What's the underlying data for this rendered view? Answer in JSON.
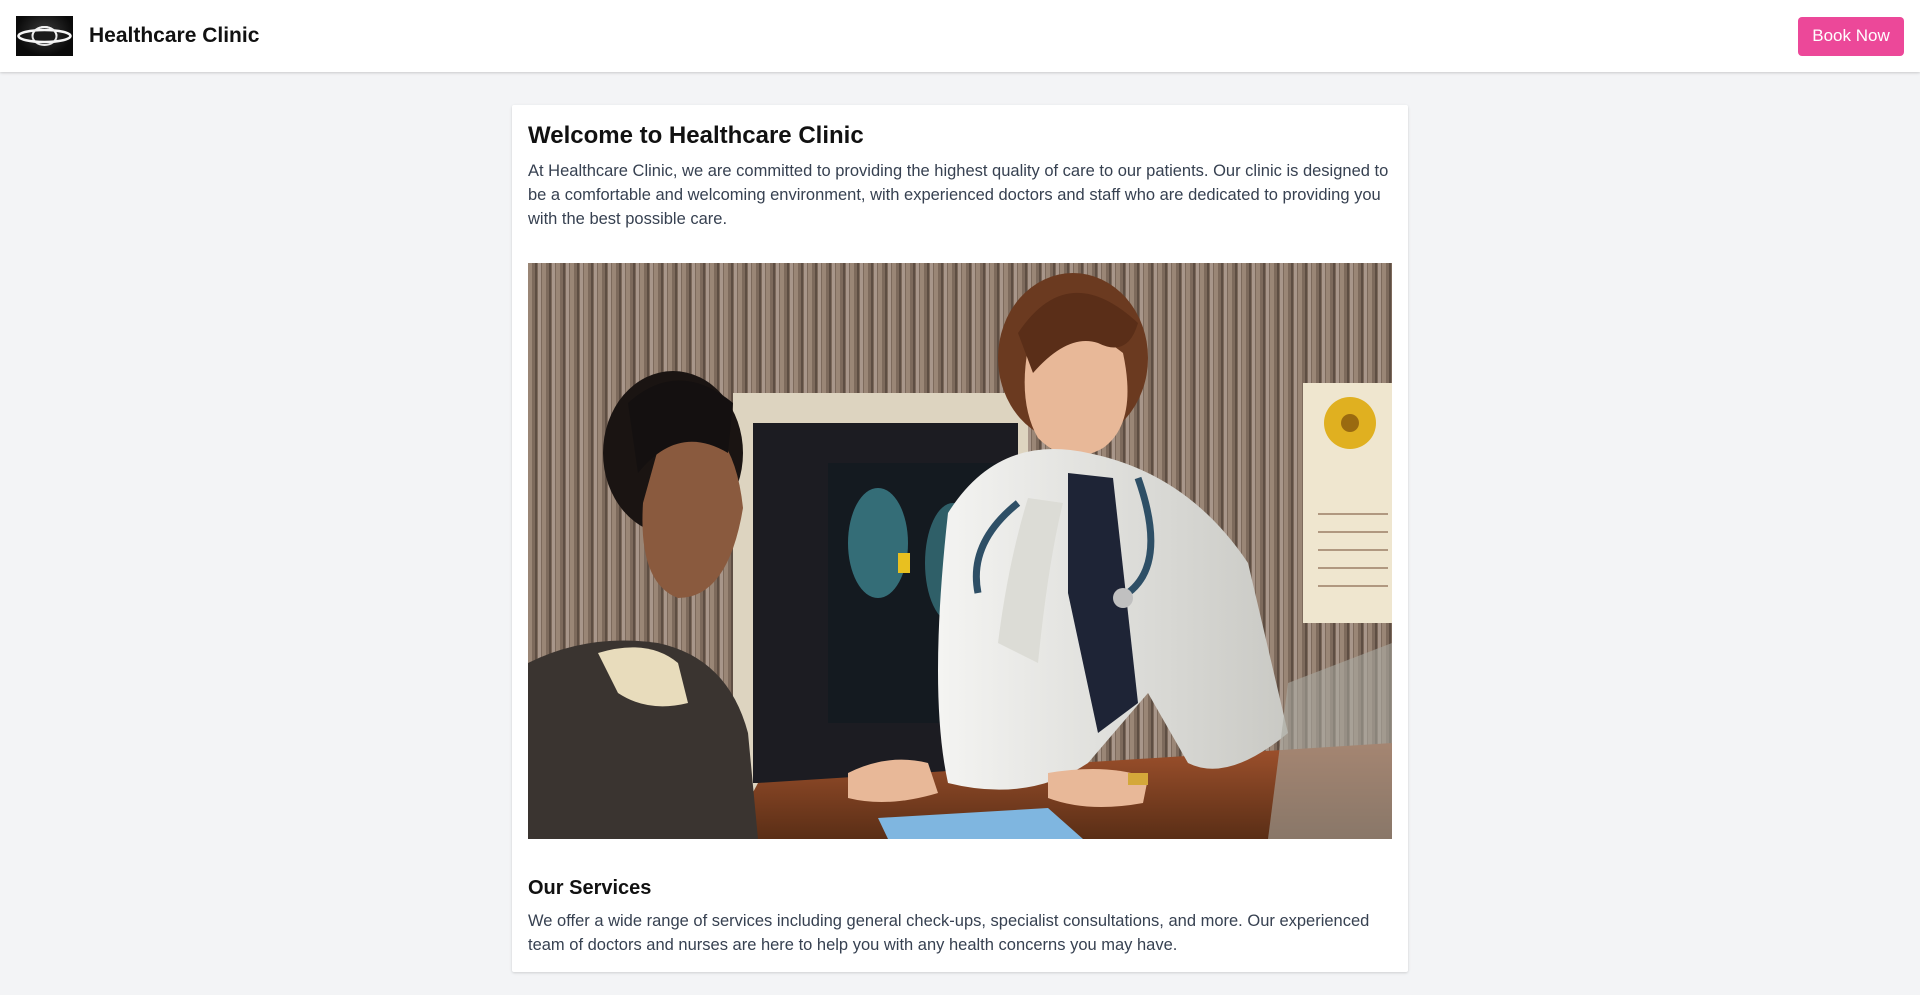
{
  "header": {
    "logo_icon": "saturn-logo-icon",
    "title": "Healthcare Clinic",
    "book_label": "Book Now"
  },
  "main": {
    "welcome_title": "Welcome to Healthcare Clinic",
    "welcome_text": "At Healthcare Clinic, we are committed to providing the highest quality of care to our patients. Our clinic is designed to be a comfortable and welcoming environment, with experienced doctors and staff who are dedicated to providing you with the best possible care.",
    "services_title": "Our Services",
    "services_text": "We offer a wide range of services including general check-ups, specialist consultations, and more. Our experienced team of doctors and nurses are here to help you with any health concerns you may have."
  },
  "colors": {
    "accent": "#ec4899",
    "page_background": "#f3f4f6",
    "card_background": "#ffffff"
  }
}
